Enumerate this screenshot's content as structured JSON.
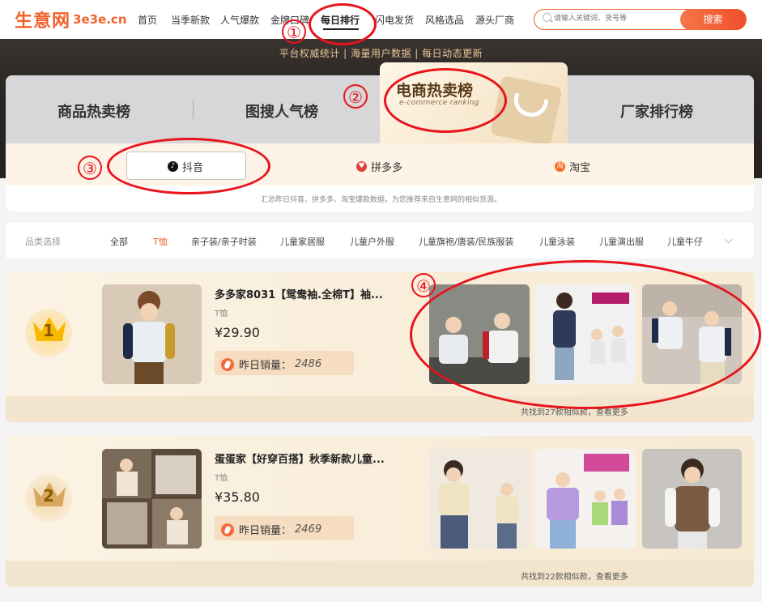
{
  "logo": {
    "cn": "生意网",
    "en": "3e3e.cn"
  },
  "nav": {
    "items": [
      "首页",
      "当季新款",
      "人气爆款",
      "金牌口碑",
      "每日排行",
      "闪电发货",
      "风格选品",
      "源头厂商"
    ],
    "active": "每日排行"
  },
  "search": {
    "placeholder": "请输入关键词、货号等",
    "button": "搜索"
  },
  "banner": {
    "tagline": "平台权威统计 | 海量用户数据 | 每日动态更新"
  },
  "tabs": {
    "goods_hot": "商品热卖榜",
    "image_search": "图搜人气榜",
    "ecommerce_title": "电商热卖榜",
    "ecommerce_sub": "e-commerce ranking",
    "factory": "厂家排行榜"
  },
  "platforms": [
    {
      "label": "抖音",
      "color": "#111111"
    },
    {
      "label": "拼多多",
      "color": "#e0403a"
    },
    {
      "label": "淘宝",
      "color": "#f36b1c"
    }
  ],
  "hint": "汇总昨日抖音、拼多多、淘宝爆款数据，为您推荐来自生意网的相似货源。",
  "categories": {
    "label": "品类选择",
    "items": [
      "全部",
      "T恤",
      "亲子装/亲子时装",
      "儿童家居服",
      "儿童户外服",
      "儿童旗袍/唐装/民族服装",
      "儿童泳装",
      "儿童演出服",
      "儿童牛仔"
    ],
    "active": "T恤"
  },
  "products": [
    {
      "rank": "1",
      "title": "多多家8031【鸳鸯袖.全棉T】袖...",
      "category": "T恤",
      "price": "¥29.90",
      "sales_label": "昨日销量：",
      "sales": "2486",
      "more": "共找到27款相似款，查看更多"
    },
    {
      "rank": "2",
      "title": "蛋蛋家【好穿百搭】秋季新款儿童...",
      "category": "T恤",
      "price": "¥35.80",
      "sales_label": "昨日销量：",
      "sales": "2469",
      "more": "共找到22款相似款，查看更多"
    }
  ],
  "annotations": [
    "①",
    "②",
    "③",
    "④"
  ],
  "colors": {
    "accent": "#f0622a",
    "annotation": "#e8131c",
    "banner": "#2a2522",
    "card": "#f7e9d2"
  }
}
